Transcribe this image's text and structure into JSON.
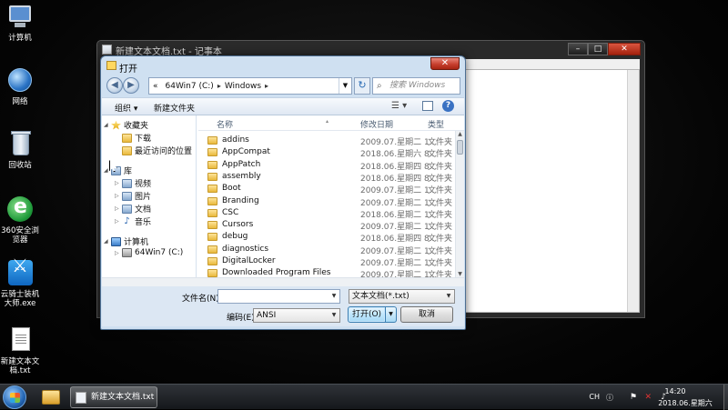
{
  "desktop": {
    "icons": [
      {
        "label": "计算机",
        "icon": "computer-icon"
      },
      {
        "label": "网络",
        "icon": "network-icon"
      },
      {
        "label": "回收站",
        "icon": "recycle-bin-icon"
      },
      {
        "label": "360安全浏览器",
        "icon": "browser-360-icon"
      },
      {
        "label": "云骑士装机大师.exe",
        "icon": "installer-icon"
      },
      {
        "label": "新建文本文档.txt",
        "icon": "text-file-icon"
      }
    ]
  },
  "notepad": {
    "title": "新建文本文档.txt - 记事本",
    "minimize": "–",
    "maximize": "□",
    "close": "✕"
  },
  "dialog": {
    "title": "打开",
    "close": "✕",
    "back": "◀",
    "forward": "▶",
    "address": {
      "prefix": "«",
      "parts": [
        "64Win7 (C:)",
        "Windows"
      ],
      "sep": "▸"
    },
    "refresh": "↻",
    "search_placeholder": "搜索 Windows",
    "toolbar": {
      "organize": "组织 ▾",
      "new_folder": "新建文件夹",
      "view": "☰ ▾",
      "help": "?"
    },
    "nav_pane": [
      {
        "label": "收藏夹",
        "icon": "star-icon",
        "tri": "◢",
        "level": 0
      },
      {
        "label": "下载",
        "icon": "folder-icon",
        "tri": "",
        "level": 1
      },
      {
        "label": "最近访问的位置",
        "icon": "folder-icon",
        "tri": "",
        "level": 1
      },
      {
        "label": "库",
        "icon": "library-icon",
        "tri": "◢",
        "level": 0
      },
      {
        "label": "视频",
        "icon": "library-icon",
        "tri": "▷",
        "level": 1
      },
      {
        "label": "图片",
        "icon": "library-icon",
        "tri": "▷",
        "level": 1
      },
      {
        "label": "文档",
        "icon": "library-icon",
        "tri": "▷",
        "level": 1
      },
      {
        "label": "音乐",
        "icon": "music-icon",
        "tri": "▷",
        "level": 1
      },
      {
        "label": "计算机",
        "icon": "computer-icon",
        "tri": "◢",
        "level": 0
      },
      {
        "label": "64Win7 (C:)",
        "icon": "drive-icon",
        "tri": "▷",
        "level": 1
      }
    ],
    "columns": {
      "name": "名称",
      "date": "修改日期",
      "type": "类型"
    },
    "files": [
      {
        "name": "addins",
        "date": "2009.07.星期二 1...",
        "type": "文件夹"
      },
      {
        "name": "AppCompat",
        "date": "2018.06.星期六 8...",
        "type": "文件夹"
      },
      {
        "name": "AppPatch",
        "date": "2018.06.星期四 8...",
        "type": "文件夹"
      },
      {
        "name": "assembly",
        "date": "2018.06.星期四 8...",
        "type": "文件夹"
      },
      {
        "name": "Boot",
        "date": "2009.07.星期二 1...",
        "type": "文件夹"
      },
      {
        "name": "Branding",
        "date": "2009.07.星期二 1...",
        "type": "文件夹"
      },
      {
        "name": "CSC",
        "date": "2018.06.星期二 1...",
        "type": "文件夹"
      },
      {
        "name": "Cursors",
        "date": "2009.07.星期二 1...",
        "type": "文件夹"
      },
      {
        "name": "debug",
        "date": "2018.06.星期四 8...",
        "type": "文件夹"
      },
      {
        "name": "diagnostics",
        "date": "2009.07.星期二 1...",
        "type": "文件夹"
      },
      {
        "name": "DigitalLocker",
        "date": "2009.07.星期二 1...",
        "type": "文件夹"
      },
      {
        "name": "Downloaded Program Files",
        "date": "2009.07.星期二 1...",
        "type": "文件夹"
      }
    ],
    "filename_label": "文件名(N):",
    "filename_value": "",
    "filetype_value": "文本文档(*.txt)",
    "encoding_label": "编码(E):",
    "encoding_value": "ANSI",
    "open_button": "打开(O)",
    "cancel_button": "取消",
    "dropdown_arrow": "▼"
  },
  "taskbar": {
    "task_label": "新建文本文档.txt ...",
    "ime": "CH",
    "time": "14:20",
    "date": "2018.06.星期六"
  }
}
